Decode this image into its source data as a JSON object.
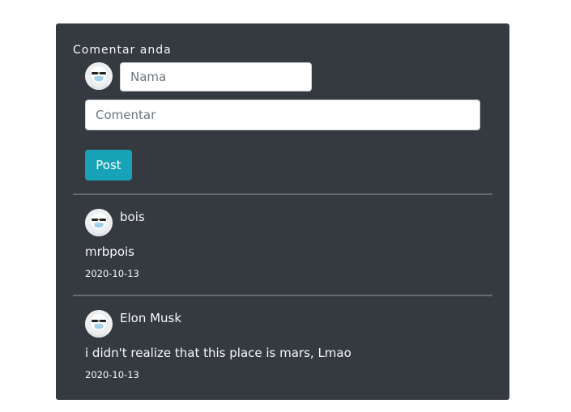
{
  "form": {
    "heading": "Comentar anda",
    "name_placeholder": "Nama",
    "comment_placeholder": "Comentar",
    "post_label": "Post",
    "avatar_icon": "masked-face-avatar-icon"
  },
  "comments": [
    {
      "author": "bois",
      "text": "mrbpois",
      "date": "2020-10-13",
      "avatar_icon": "masked-face-avatar-icon"
    },
    {
      "author": "Elon Musk",
      "text": "i didn't realize that this place is mars, Lmao",
      "date": "2020-10-13",
      "avatar_icon": "masked-face-avatar-icon"
    }
  ],
  "colors": {
    "panel_bg": "#343a40",
    "button_bg": "#17a2b8",
    "divider": "#6c757d",
    "text": "#f8f9fa"
  }
}
